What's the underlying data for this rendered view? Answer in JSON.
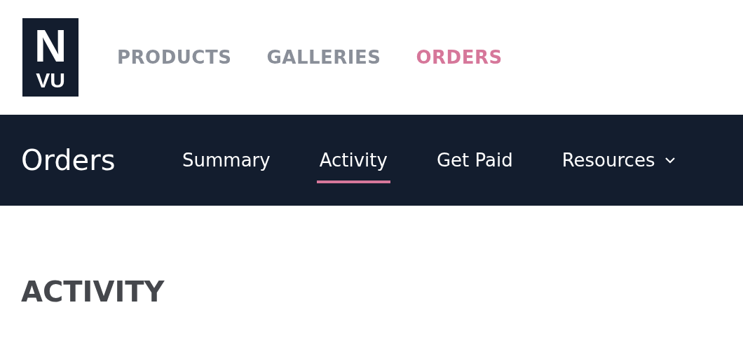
{
  "logo": {
    "top": "N",
    "bottom": "VU"
  },
  "main_nav": [
    {
      "label": "PRODUCTS",
      "selected": false
    },
    {
      "label": "GALLERIES",
      "selected": false
    },
    {
      "label": "ORDERS",
      "selected": true
    }
  ],
  "section_bar": {
    "title": "Orders",
    "tabs": [
      {
        "label": "Summary",
        "selected": false,
        "kind": "link"
      },
      {
        "label": "Activity",
        "selected": true,
        "kind": "link"
      },
      {
        "label": "Get Paid",
        "selected": false,
        "kind": "link"
      },
      {
        "label": "Resources",
        "selected": false,
        "kind": "dropdown"
      }
    ]
  },
  "page_heading": "ACTIVITY"
}
